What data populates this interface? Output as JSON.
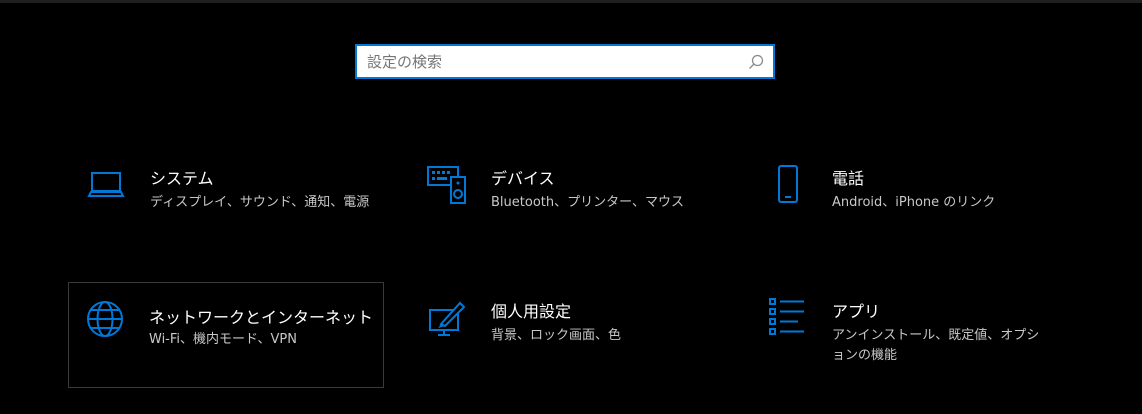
{
  "search": {
    "placeholder": "設定の検索",
    "value": ""
  },
  "colors": {
    "accent": "#0078d7",
    "background": "#000000",
    "text": "#ffffff",
    "subtext": "#c8c8c8"
  },
  "tiles": [
    {
      "title": "システム",
      "desc": "ディスプレイ、サウンド、通知、電源",
      "icon": "laptop-icon"
    },
    {
      "title": "デバイス",
      "desc": "Bluetooth、プリンター、マウス",
      "icon": "devices-icon"
    },
    {
      "title": "電話",
      "desc": "Android、iPhone のリンク",
      "icon": "phone-icon"
    },
    {
      "title": "ネットワークとインターネット",
      "desc": "Wi-Fi、機内モード、VPN",
      "icon": "globe-icon"
    },
    {
      "title": "個人用設定",
      "desc": "背景、ロック画面、色",
      "icon": "personalization-icon"
    },
    {
      "title": "アプリ",
      "desc": "アンインストール、既定値、オプションの機能",
      "icon": "apps-list-icon"
    }
  ]
}
